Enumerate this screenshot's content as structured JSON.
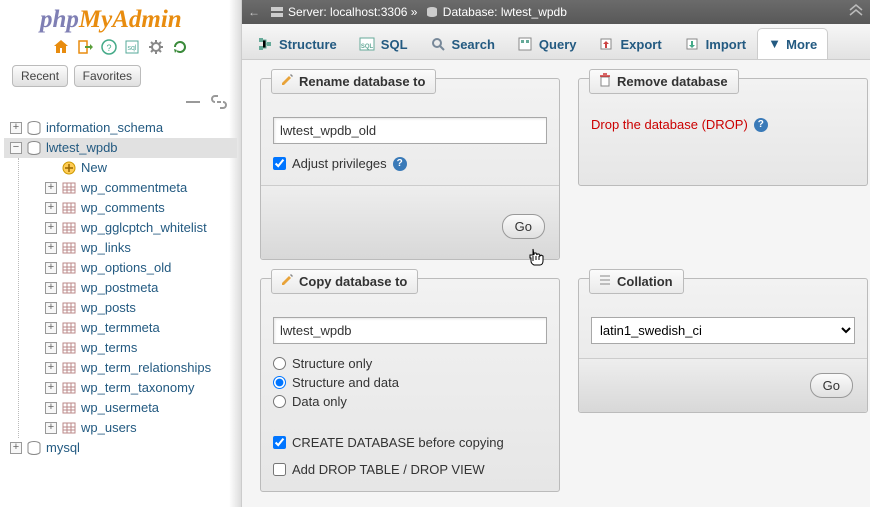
{
  "logo": {
    "php": "php",
    "my": "My",
    "admin": "Admin"
  },
  "nav": {
    "recent": "Recent",
    "favorites": "Favorites"
  },
  "tree": {
    "db1": "information_schema",
    "db2": "lwtest_wpdb",
    "new": "New",
    "tables": [
      "wp_commentmeta",
      "wp_comments",
      "wp_gglcptch_whitelist",
      "wp_links",
      "wp_options_old",
      "wp_postmeta",
      "wp_posts",
      "wp_termmeta",
      "wp_terms",
      "wp_term_relationships",
      "wp_term_taxonomy",
      "wp_usermeta",
      "wp_users"
    ],
    "db3": "mysql"
  },
  "breadcrumb": {
    "server_lbl": "Server:",
    "server": "localhost:3306",
    "sep": "»",
    "db_lbl": "Database:",
    "db": "lwtest_wpdb"
  },
  "tabs": {
    "structure": "Structure",
    "sql": "SQL",
    "search": "Search",
    "query": "Query",
    "export": "Export",
    "import": "Import",
    "more": "More"
  },
  "rename": {
    "title": "Rename database to",
    "value": "lwtest_wpdb_old",
    "adjust": "Adjust privileges",
    "go": "Go"
  },
  "remove": {
    "title": "Remove database",
    "drop": "Drop the database (DROP)"
  },
  "copy": {
    "title": "Copy database to",
    "value": "lwtest_wpdb",
    "opt1": "Structure only",
    "opt2": "Structure and data",
    "opt3": "Data only",
    "create": "CREATE DATABASE before copying",
    "adddrop": "Add DROP TABLE / DROP VIEW"
  },
  "collation": {
    "title": "Collation",
    "value": "latin1_swedish_ci",
    "go": "Go"
  }
}
